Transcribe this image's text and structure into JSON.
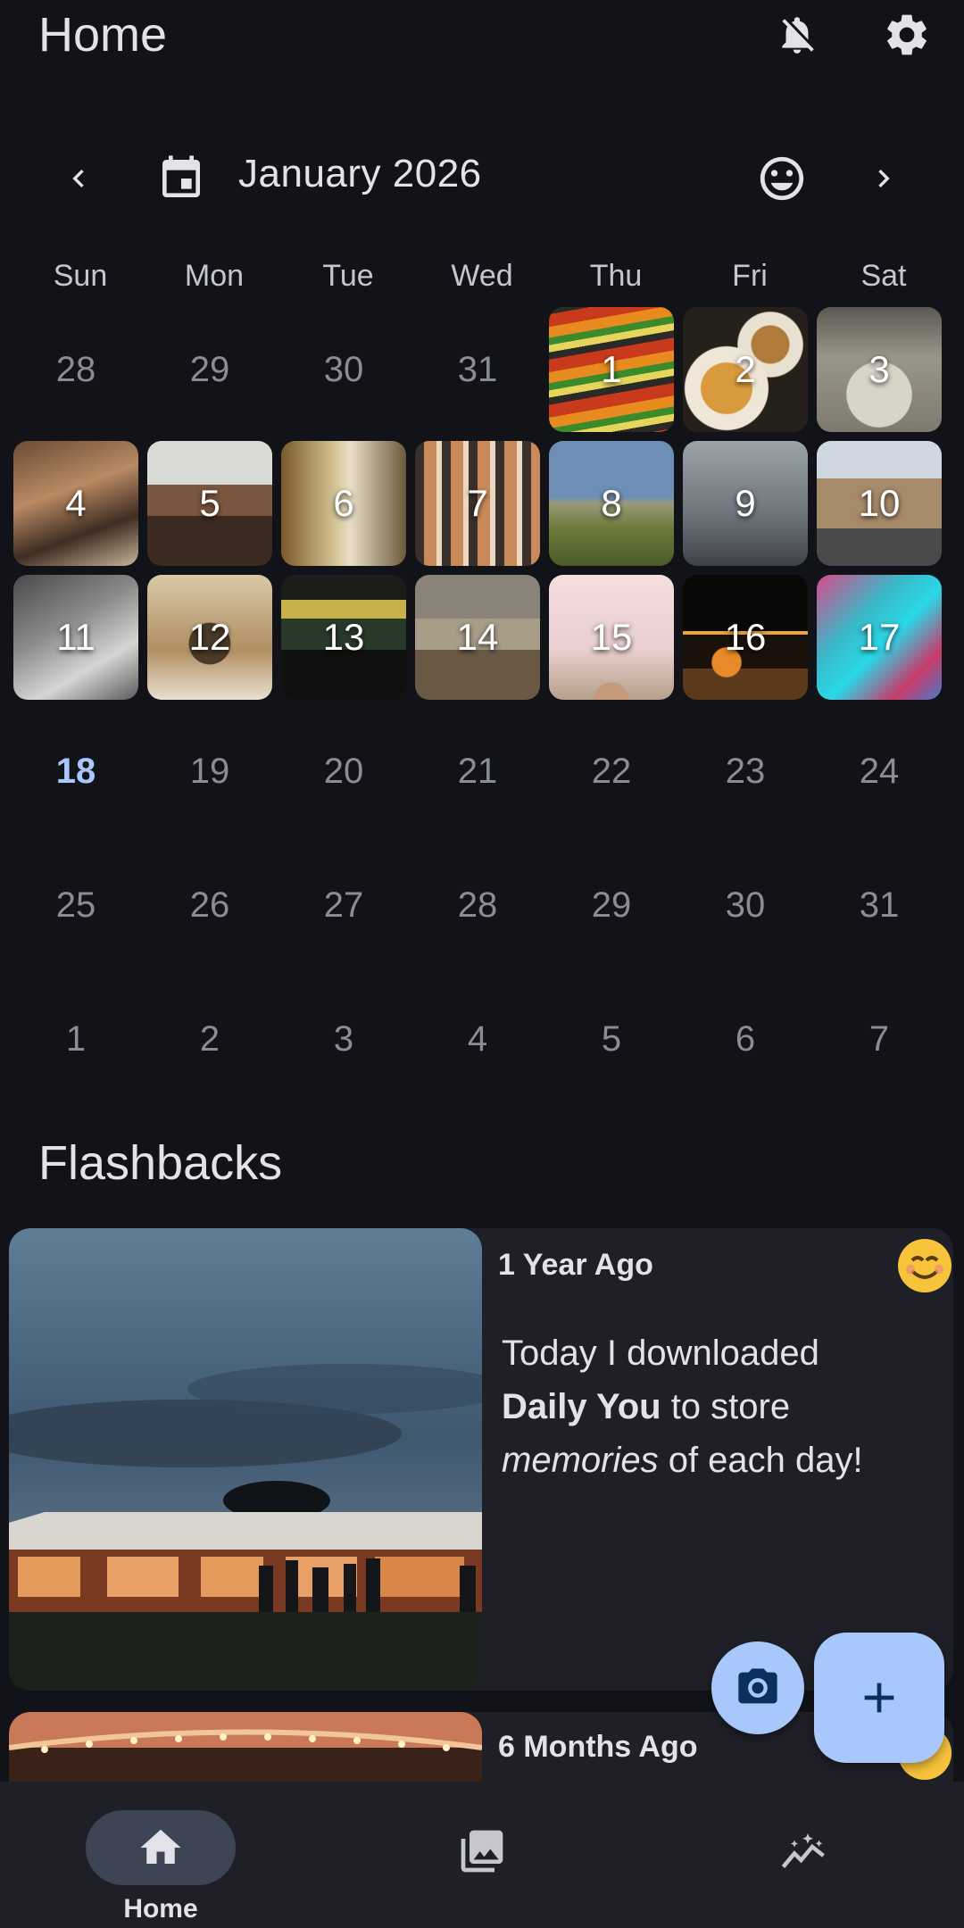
{
  "appbar": {
    "title": "Home",
    "icons": [
      "notifications-off-icon",
      "settings-icon"
    ]
  },
  "calendar": {
    "month_label": "January 2026",
    "weekdays": [
      "Sun",
      "Mon",
      "Tue",
      "Wed",
      "Thu",
      "Fri",
      "Sat"
    ],
    "today": "18",
    "days": [
      "28",
      "29",
      "30",
      "31",
      "1",
      "2",
      "3",
      "4",
      "5",
      "6",
      "7",
      "8",
      "9",
      "10",
      "11",
      "12",
      "13",
      "14",
      "15",
      "16",
      "17",
      "18",
      "19",
      "20",
      "21",
      "22",
      "23",
      "24",
      "25",
      "26",
      "27",
      "28",
      "29",
      "30",
      "31",
      "1",
      "2",
      "3",
      "4",
      "5",
      "6",
      "7"
    ]
  },
  "flashbacks": {
    "title": "Flashbacks",
    "cards": [
      {
        "ago": "1 Year Ago",
        "text_plain_1": "Today I downloaded",
        "text_bold": "Daily You",
        "text_plain_2": " to store",
        "text_italic": "memories",
        "text_plain_3": " of each day!"
      },
      {
        "ago": "6 Months Ago"
      }
    ]
  },
  "bottom_nav": {
    "items": [
      {
        "label": "Home",
        "icon": "home-icon",
        "selected": true
      },
      {
        "label": "",
        "icon": "gallery-icon",
        "selected": false
      },
      {
        "label": "",
        "icon": "insights-icon",
        "selected": false
      }
    ]
  },
  "colors": {
    "background": "#121318",
    "surface": "#1f2027",
    "accent": "#a8c7fa",
    "pill": "#3d4554"
  }
}
